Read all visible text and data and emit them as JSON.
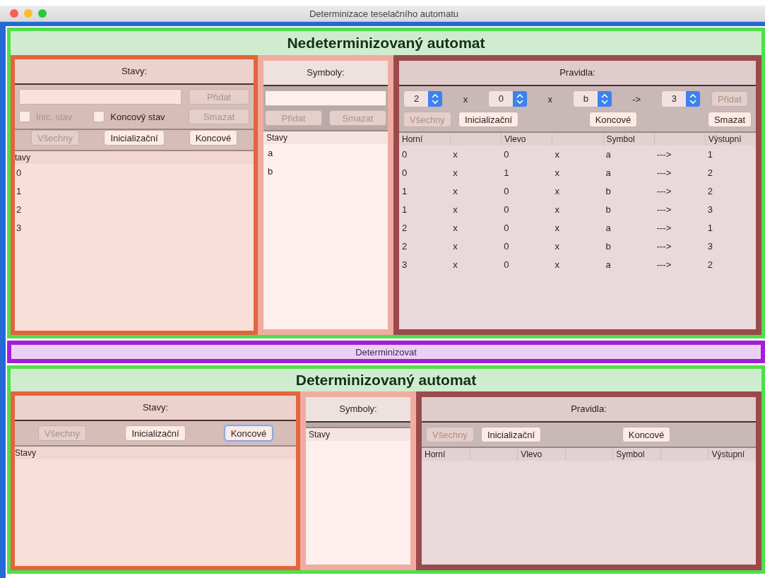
{
  "window": {
    "title": "Determinizace teselačního automatu"
  },
  "nondeterministic": {
    "heading": "Nedeterminizovaný automat",
    "states_panel": {
      "title": "Stavy:",
      "add_button": {
        "label": "Přidat",
        "disabled": true
      },
      "checkboxes": [
        {
          "label": "Inic. stav",
          "checked": false,
          "disabled": true
        },
        {
          "label": "Koncový stav",
          "checked": false,
          "disabled": false
        }
      ],
      "delete_button": {
        "label": "Smazat",
        "disabled": true
      },
      "filter_buttons": [
        {
          "label": "Všechny",
          "disabled": true,
          "focused": false
        },
        {
          "label": "Inicializační",
          "disabled": false,
          "focused": false
        },
        {
          "label": "Koncové",
          "disabled": false,
          "focused": false
        }
      ],
      "list": {
        "header": "tavy",
        "items": [
          "0",
          "1",
          "2",
          "3"
        ]
      }
    },
    "symbols_panel": {
      "title": "Symboly:",
      "add_button": {
        "label": "Přidat",
        "disabled": true
      },
      "delete_button": {
        "label": "Smazat",
        "disabled": true
      },
      "list": {
        "header": "Stavy",
        "items": [
          "a",
          "b"
        ]
      }
    },
    "rules_panel": {
      "title": "Pravidla:",
      "rule_inputs": [
        {
          "kind": "select",
          "value": "2"
        },
        {
          "kind": "operator",
          "text": "x"
        },
        {
          "kind": "select",
          "value": "0"
        },
        {
          "kind": "operator",
          "text": "x"
        },
        {
          "kind": "select",
          "value": "b"
        },
        {
          "kind": "operator",
          "text": "->"
        },
        {
          "kind": "select",
          "value": "3"
        }
      ],
      "add_button": {
        "label": "Přidat",
        "disabled": true
      },
      "filter_buttons": [
        {
          "label": "Všechny",
          "disabled": true,
          "focused": false
        },
        {
          "label": "Inicializační",
          "disabled": false,
          "focused": false
        },
        {
          "label": "Koncové",
          "disabled": false,
          "focused": false
        }
      ],
      "delete_button": {
        "label": "Smazat",
        "disabled": false
      },
      "columns": [
        "Horní",
        "",
        "Vlevo",
        "",
        "Symbol",
        "",
        "Výstupní"
      ],
      "rows": [
        [
          "0",
          "x",
          "0",
          "x",
          "a",
          "--->",
          "1"
        ],
        [
          "0",
          "x",
          "1",
          "x",
          "a",
          "--->",
          "2"
        ],
        [
          "1",
          "x",
          "0",
          "x",
          "b",
          "--->",
          "2"
        ],
        [
          "1",
          "x",
          "0",
          "x",
          "b",
          "--->",
          "3"
        ],
        [
          "2",
          "x",
          "0",
          "x",
          "a",
          "--->",
          "1"
        ],
        [
          "2",
          "x",
          "0",
          "x",
          "b",
          "--->",
          "3"
        ],
        [
          "3",
          "x",
          "0",
          "x",
          "a",
          "--->",
          "2"
        ]
      ]
    }
  },
  "determinize_button": {
    "label": "Determinizovat"
  },
  "deterministic": {
    "heading": "Determinizovaný automat",
    "states_panel": {
      "title": "Stavy:",
      "filter_buttons": [
        {
          "label": "Všechny",
          "disabled": true,
          "focused": false
        },
        {
          "label": "Inicializační",
          "disabled": false,
          "focused": false
        },
        {
          "label": "Koncové",
          "disabled": false,
          "focused": true
        }
      ],
      "list": {
        "header": "Stavy"
      }
    },
    "symbols_panel": {
      "title": "Symboly:",
      "list": {
        "header": "Stavy"
      }
    },
    "rules_panel": {
      "title": "Pravidla:",
      "filter_buttons": [
        {
          "label": "Všechny",
          "disabled": true,
          "focused": false
        },
        {
          "label": "Inicializační",
          "disabled": false,
          "focused": false
        },
        {
          "label": "Koncové",
          "disabled": false,
          "focused": false
        }
      ],
      "columns": [
        "Horní",
        "",
        "Vlevo",
        "",
        "Symbol",
        "",
        "Výstupní"
      ]
    }
  }
}
